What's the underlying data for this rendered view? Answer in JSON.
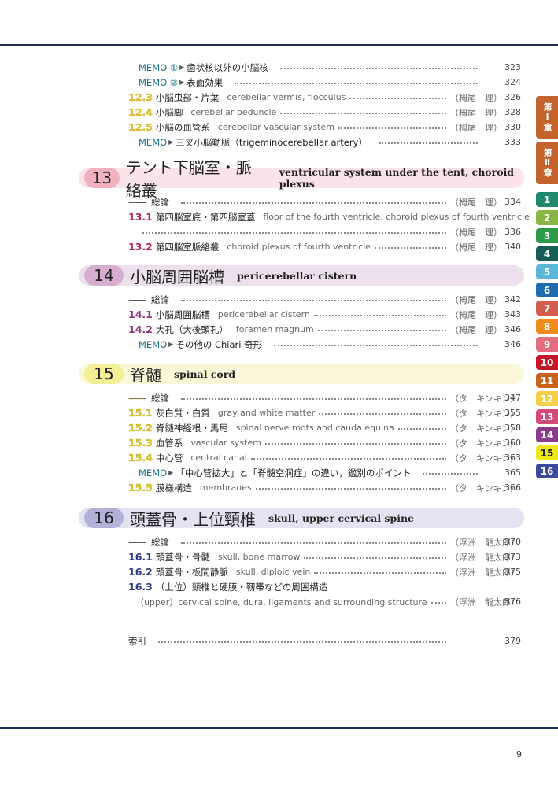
{
  "top_entries": [
    {
      "type": "memo",
      "label": "MEMO ①",
      "text": "歯状核以外の小脳核",
      "page": "323"
    },
    {
      "type": "memo",
      "label": "MEMO ②",
      "text": "表面効果",
      "page": "324"
    },
    {
      "type": "entry",
      "num": "12.3",
      "jp": "小脳虫部・片葉",
      "en": "cerebellar vermis, flocculus",
      "author": "（栂尾　理）",
      "page": "326"
    },
    {
      "type": "entry",
      "num": "12.4",
      "jp": "小脳脚",
      "en": "cerebellar peduncle",
      "author": "（栂尾　理）",
      "page": "328"
    },
    {
      "type": "entry",
      "num": "12.5",
      "jp": "小脳の血管系",
      "en": "cerebellar vascular system",
      "author": "（栂尾　理）",
      "page": "330"
    },
    {
      "type": "memo",
      "label": "MEMO",
      "text": "三叉小脳動脈（trigeminocerebellar artery）",
      "page": "333"
    }
  ],
  "top_num_color": "#e6c234",
  "chapters": [
    {
      "num": "13",
      "title": "テント下脳室・脈絡叢",
      "title_en": "ventricular system under the tent, choroid plexus",
      "pill_color": "#f1b2bf",
      "band_color": "#fbe4e9",
      "num_color": "#b8255a",
      "entries": [
        {
          "type": "overview",
          "num": "——",
          "jp": "総論",
          "author": "（栂尾　理）",
          "page": "334"
        },
        {
          "type": "entry",
          "num": "13.1",
          "jp": "第四脳室底・第四脳室蓋",
          "en": "floor of the fourth ventricle, choroid plexus of fourth ventricle",
          "wrap": true
        },
        {
          "type": "cont",
          "author": "（栂尾　理）",
          "page": "336"
        },
        {
          "type": "entry",
          "num": "13.2",
          "jp": "第四脳室脈絡叢",
          "en": "choroid plexus of fourth ventricle",
          "author": "（栂尾　理）",
          "page": "340"
        }
      ]
    },
    {
      "num": "14",
      "title": "小脳周囲脳槽",
      "title_en": "pericerebellar cistern",
      "pill_color": "#d7aed0",
      "band_color": "#ede0ed",
      "num_color": "#8a2f7e",
      "entries": [
        {
          "type": "overview",
          "num": "——",
          "jp": "総論",
          "author": "（栂尾　理）",
          "page": "342"
        },
        {
          "type": "entry",
          "num": "14.1",
          "jp": "小脳周囲脳槽",
          "en": "pericerebellar cistern",
          "author": "（栂尾　理）",
          "page": "343"
        },
        {
          "type": "entry",
          "num": "14.2",
          "jp": "大孔（大後頭孔）",
          "en": "foramen magnum",
          "author": "（栂尾　理）",
          "page": "346"
        },
        {
          "type": "memo",
          "label": "MEMO",
          "text": "その他の Chiari 奇形",
          "page": "346"
        }
      ]
    },
    {
      "num": "15",
      "title": "脊髄",
      "title_en": "spinal cord",
      "pill_color": "#f3ee98",
      "band_color": "#fbf8da",
      "num_color": "#d9c72a",
      "entries": [
        {
          "type": "overview",
          "num": "——",
          "jp": "総論",
          "author": "（タ　キンキン）",
          "page": "347"
        },
        {
          "type": "entry",
          "num": "15.1",
          "jp": "灰白質・白質",
          "en": "gray and white matter",
          "author": "（タ　キンキン）",
          "page": "355"
        },
        {
          "type": "entry",
          "num": "15.2",
          "jp": "脊髄神経根・馬尾",
          "en": "spinal nerve roots and cauda equina",
          "author": "（タ　キンキン）",
          "page": "358"
        },
        {
          "type": "entry",
          "num": "15.3",
          "jp": "血管系",
          "en": "vascular system",
          "author": "（タ　キンキン）",
          "page": "360"
        },
        {
          "type": "entry",
          "num": "15.4",
          "jp": "中心管",
          "en": "central canal",
          "author": "（タ　キンキン）",
          "page": "363"
        },
        {
          "type": "memo",
          "label": "MEMO",
          "text": "「中心管拡大」と「脊髄空洞症」の違い，鑑別のポイント",
          "page": "365"
        },
        {
          "type": "entry",
          "num": "15.5",
          "jp": "膜様構造",
          "en": "membranes",
          "author": "（タ　キンキン）",
          "page": "366"
        }
      ]
    },
    {
      "num": "16",
      "title": "頭蓋骨・上位頸椎",
      "title_en": "skull, upper cervical spine",
      "pill_color": "#b4b1d8",
      "band_color": "#e4e3f1",
      "num_color": "#2b3a86",
      "entries": [
        {
          "type": "overview",
          "num": "——",
          "jp": "総論",
          "author": "（浮洲　龍太郎）",
          "page": "370"
        },
        {
          "type": "entry",
          "num": "16.1",
          "jp": "頭蓋骨・骨髄",
          "en": "skull, bone marrow",
          "author": "（浮洲　龍太郎）",
          "page": "373"
        },
        {
          "type": "entry",
          "num": "16.2",
          "jp": "頭蓋骨・板間静脈",
          "en": "skull, diploic vein",
          "author": "（浮洲　龍太郎）",
          "page": "375"
        },
        {
          "type": "entry",
          "num": "16.3",
          "jp": "（上位）頸椎と硬膜・靱帯などの周囲構造",
          "wrap": true
        },
        {
          "type": "cont",
          "en": "（upper）cervical spine, dura, ligaments and surrounding structure",
          "author": "（浮洲　龍太郎）",
          "page": "376"
        }
      ]
    }
  ],
  "index": {
    "label": "索引",
    "page": "379"
  },
  "tabs": [
    {
      "label": "第Ⅰ章",
      "color": "#c4622d"
    },
    {
      "label": "第Ⅱ章",
      "color": "#c4622d"
    },
    {
      "label": "1",
      "color": "#1f8a6c"
    },
    {
      "label": "2",
      "color": "#8ab546"
    },
    {
      "label": "3",
      "color": "#2a9a4a"
    },
    {
      "label": "4",
      "color": "#175c55"
    },
    {
      "label": "5",
      "color": "#5ab7d8"
    },
    {
      "label": "6",
      "color": "#1e6bb0"
    },
    {
      "label": "7",
      "color": "#d25b52"
    },
    {
      "label": "8",
      "color": "#ee8c1e"
    },
    {
      "label": "9",
      "color": "#e26e7f"
    },
    {
      "label": "10",
      "color": "#c2182a"
    },
    {
      "label": "11",
      "color": "#c8641e"
    },
    {
      "label": "12",
      "color": "#f5cf4a"
    },
    {
      "label": "13",
      "color": "#d44a77"
    },
    {
      "label": "14",
      "color": "#8a3b8e"
    },
    {
      "label": "15",
      "color": "#eee81a"
    },
    {
      "label": "16",
      "color": "#3a4aa0"
    }
  ],
  "page_number": "9"
}
